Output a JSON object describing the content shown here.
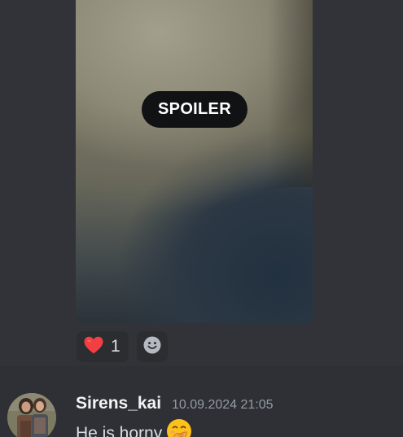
{
  "attachment": {
    "spoiler_label": "SPOILER"
  },
  "reactions": [
    {
      "emoji": "red-heart",
      "count": "1"
    }
  ],
  "message": {
    "username": "Sirens_kai",
    "timestamp": "10.09.2024 21:05",
    "text": "He is horny",
    "emoji": "hand-over-mouth"
  },
  "colors": {
    "background": "#313338",
    "message_hover": "#2e3035",
    "spoiler_pill": "#111214",
    "reaction_bg": "#2b2d31",
    "heart": "#f23f43",
    "username": "#f2f3f5",
    "timestamp": "#949ba4",
    "text": "#dbdee1"
  }
}
